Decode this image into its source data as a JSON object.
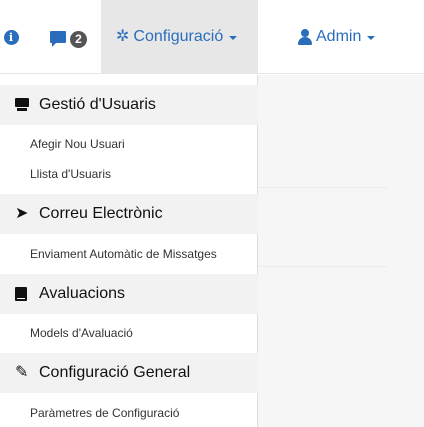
{
  "navbar": {
    "info_icon": "i",
    "messages_badge": "2",
    "config_icon": "✲",
    "config_label": "Configuració",
    "admin_label": "Admin"
  },
  "menu": {
    "user_management": {
      "title": "Gestió d'Usuaris",
      "items": [
        "Afegir Nou Usuari",
        "Llista d'Usuaris"
      ]
    },
    "email": {
      "title": "Correu Electrònic",
      "items": [
        "Enviament Automàtic de Missatges"
      ]
    },
    "evaluations": {
      "title": "Avaluacions",
      "items": [
        "Models d'Avaluació"
      ]
    },
    "general_config": {
      "title": "Configuració General",
      "items": [
        "Paràmetres de Configuració"
      ]
    }
  },
  "icons": {
    "info": "info-circle-icon",
    "messages": "comment-icon",
    "config": "cog-icon",
    "admin": "user-icon",
    "user_management": "monitor-icon",
    "email": "send-icon",
    "evaluations": "book-icon",
    "general_config": "wrench-icon"
  },
  "colors": {
    "link": "#2a6ebb",
    "active_nav_bg": "#e7e7e7",
    "menu_header_bg": "#f2f2f2",
    "badge_bg": "#555555"
  }
}
